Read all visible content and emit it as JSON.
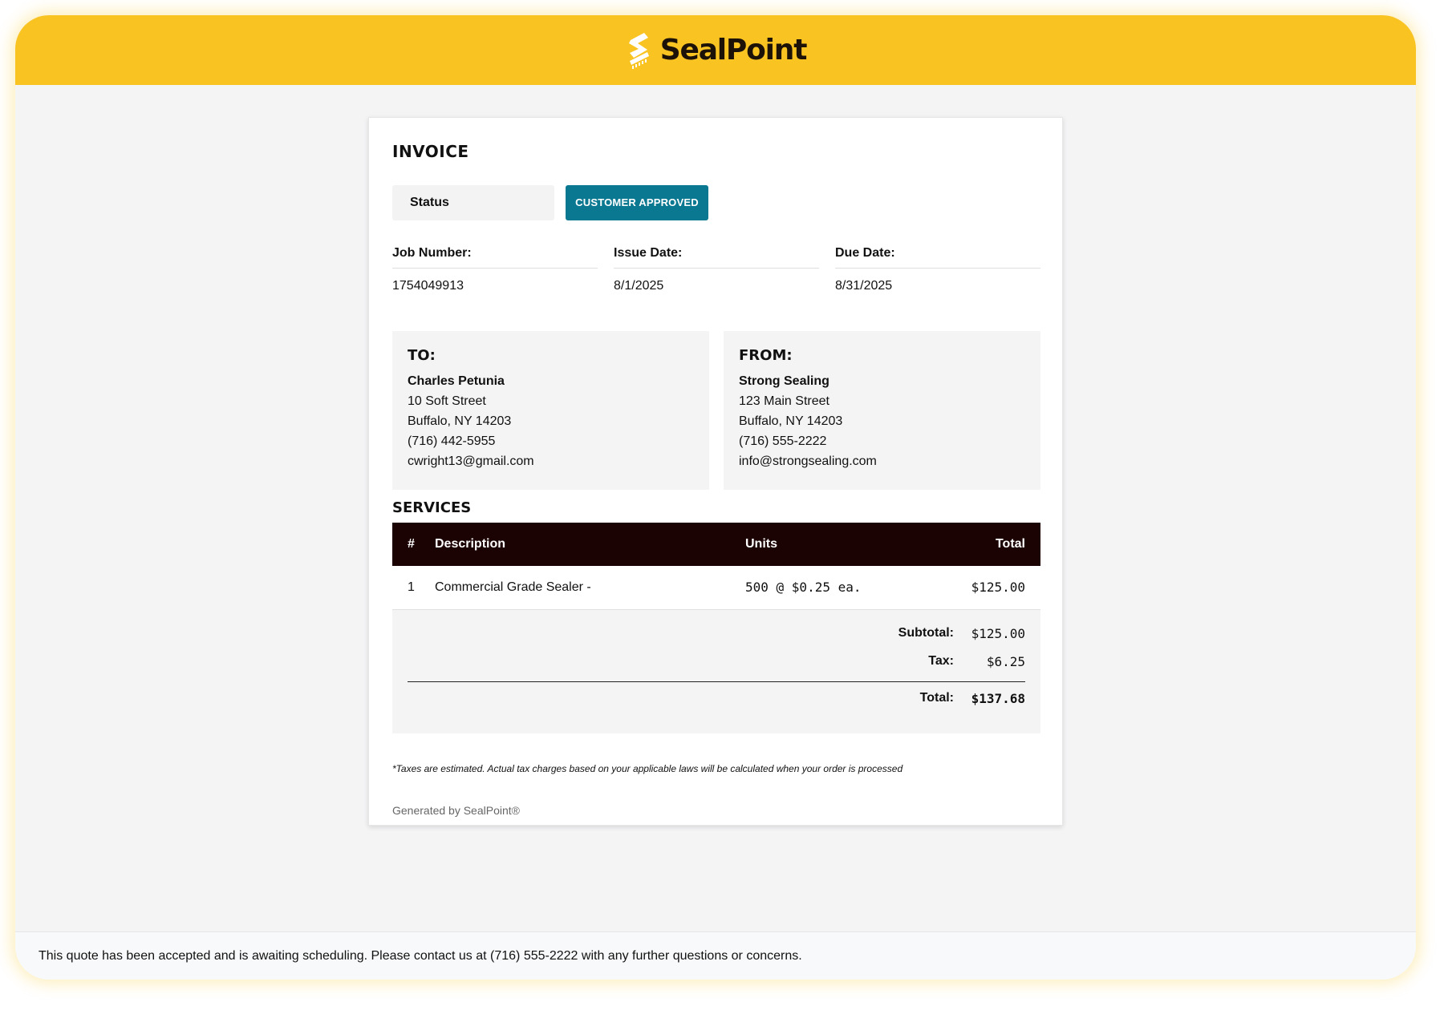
{
  "brand": {
    "name": "SealPoint",
    "logo_icon": "sealpoint-logo-icon",
    "bar_color": "#f9c322"
  },
  "invoice": {
    "title": "INVOICE",
    "status_label": "Status",
    "status_value": "CUSTOMER APPROVED",
    "status_color": "#0b7891",
    "meta": [
      {
        "label": "Job Number:",
        "value": "1754049913"
      },
      {
        "label": "Issue Date:",
        "value": "8/1/2025"
      },
      {
        "label": "Due Date:",
        "value": "8/31/2025"
      }
    ],
    "to": {
      "heading": "TO:",
      "name": "Charles Petunia",
      "street": "10 Soft Street",
      "city": "Buffalo, NY 14203",
      "phone": "(716) 442-5955",
      "email": "cwright13@gmail.com"
    },
    "from": {
      "heading": "FROM:",
      "name": "Strong Sealing",
      "street": "123 Main Street",
      "city": "Buffalo, NY 14203",
      "phone": "(716) 555-2222",
      "email": "info@strongsealing.com"
    },
    "services": {
      "title": "SERVICES",
      "columns": {
        "num": "#",
        "description": "Description",
        "units": "Units",
        "total": "Total"
      },
      "rows": [
        {
          "num": "1",
          "description": "Commercial Grade Sealer -",
          "units": "500 @ $0.25 ea.",
          "total": "$125.00"
        }
      ],
      "header_color": "#1c0303"
    },
    "totals": {
      "subtotal_label": "Subtotal:",
      "subtotal_value": "$125.00",
      "tax_label": "Tax:",
      "tax_value": "$6.25",
      "total_label": "Total:",
      "total_value": "$137.68"
    },
    "tax_note": "*Taxes are estimated. Actual tax charges based on your applicable laws will be calculated when your order is processed",
    "generated_by": "Generated by SealPoint®"
  },
  "footer": {
    "message": "This quote has been accepted and is awaiting scheduling. Please contact us at (716) 555-2222 with any further questions or concerns."
  }
}
